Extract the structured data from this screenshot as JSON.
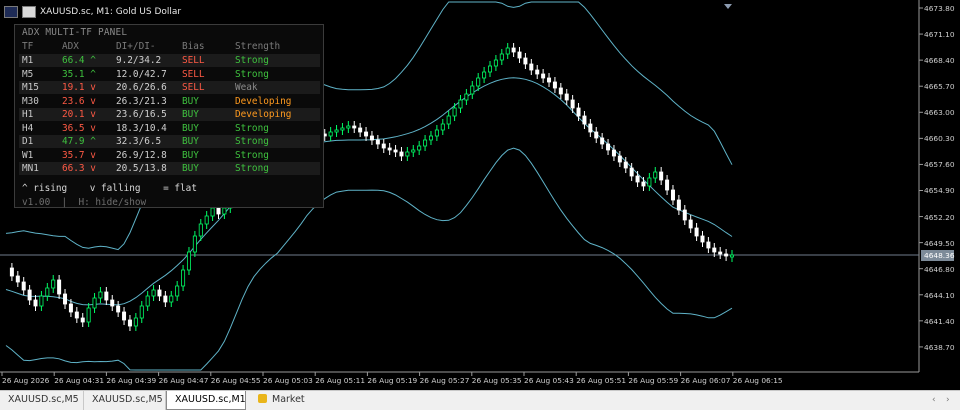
{
  "window": {
    "title": "XAUUSD.sc, M1:  Gold US Dollar"
  },
  "panel": {
    "title": "ADX MULTI-TF PANEL",
    "headers": [
      "TF",
      "ADX",
      "DI+/DI-",
      "Bias",
      "Strength"
    ],
    "rows": [
      {
        "tf": "M1",
        "adx": "66.4 ^",
        "di": "9.2/34.2",
        "bias": "SELL",
        "strength": "Strong"
      },
      {
        "tf": "M5",
        "adx": "35.1 ^",
        "di": "12.0/42.7",
        "bias": "SELL",
        "strength": "Strong"
      },
      {
        "tf": "M15",
        "adx": "19.1 v",
        "di": "20.6/26.6",
        "bias": "SELL",
        "strength": "Weak"
      },
      {
        "tf": "M30",
        "adx": "23.6 v",
        "di": "26.3/21.3",
        "bias": "BUY",
        "strength": "Developing"
      },
      {
        "tf": "H1",
        "adx": "20.1 v",
        "di": "23.6/16.5",
        "bias": "BUY",
        "strength": "Developing"
      },
      {
        "tf": "H4",
        "adx": "36.5 v",
        "di": "18.3/10.4",
        "bias": "BUY",
        "strength": "Strong"
      },
      {
        "tf": "D1",
        "adx": "47.9 ^",
        "di": "32.3/6.5",
        "bias": "BUY",
        "strength": "Strong"
      },
      {
        "tf": "W1",
        "adx": "35.7 v",
        "di": "26.9/12.8",
        "bias": "BUY",
        "strength": "Strong"
      },
      {
        "tf": "MN1",
        "adx": "66.3 v",
        "di": "20.5/13.8",
        "bias": "BUY",
        "strength": "Strong"
      }
    ],
    "legend": "^ rising    v falling    = flat",
    "footer": "v1.00  |  H: hide/show"
  },
  "price_axis": [
    "4673.80",
    "4671.10",
    "4668.40",
    "4665.70",
    "4663.00",
    "4660.30",
    "4657.60",
    "4654.90",
    "4652.20",
    "4649.50",
    "4646.80",
    "4644.10",
    "4641.40",
    "4638.70"
  ],
  "current_price": "4648.36",
  "time_axis": [
    "26 Aug 2026",
    "26 Aug 04:31",
    "26 Aug 04:39",
    "26 Aug 04:47",
    "26 Aug 04:55",
    "26 Aug 05:03",
    "26 Aug 05:11",
    "26 Aug 05:19",
    "26 Aug 05:27",
    "26 Aug 05:35",
    "26 Aug 05:43",
    "26 Aug 05:51",
    "26 Aug 05:59",
    "26 Aug 06:07",
    "26 Aug 06:15"
  ],
  "tabs": [
    {
      "label": "XAUUSD.sc,M5",
      "active": false
    },
    {
      "label": "XAUUSD.sc,M5",
      "active": false
    },
    {
      "label": "XAUUSD.sc,M1",
      "active": true
    },
    {
      "label": "Market",
      "active": false
    }
  ],
  "colors": {
    "bull": "#00ff66",
    "bear": "#ffffff",
    "band": "#5fb3c8",
    "sell": "#ff5a45",
    "buy": "#3fc23f",
    "strong": "#3fc23f",
    "developing": "#ff9a1f",
    "weak": "#8a8a8a",
    "adx_rising": "#3fc23f",
    "adx_falling": "#ff5a45",
    "gridline": "#6f7d8c"
  }
}
